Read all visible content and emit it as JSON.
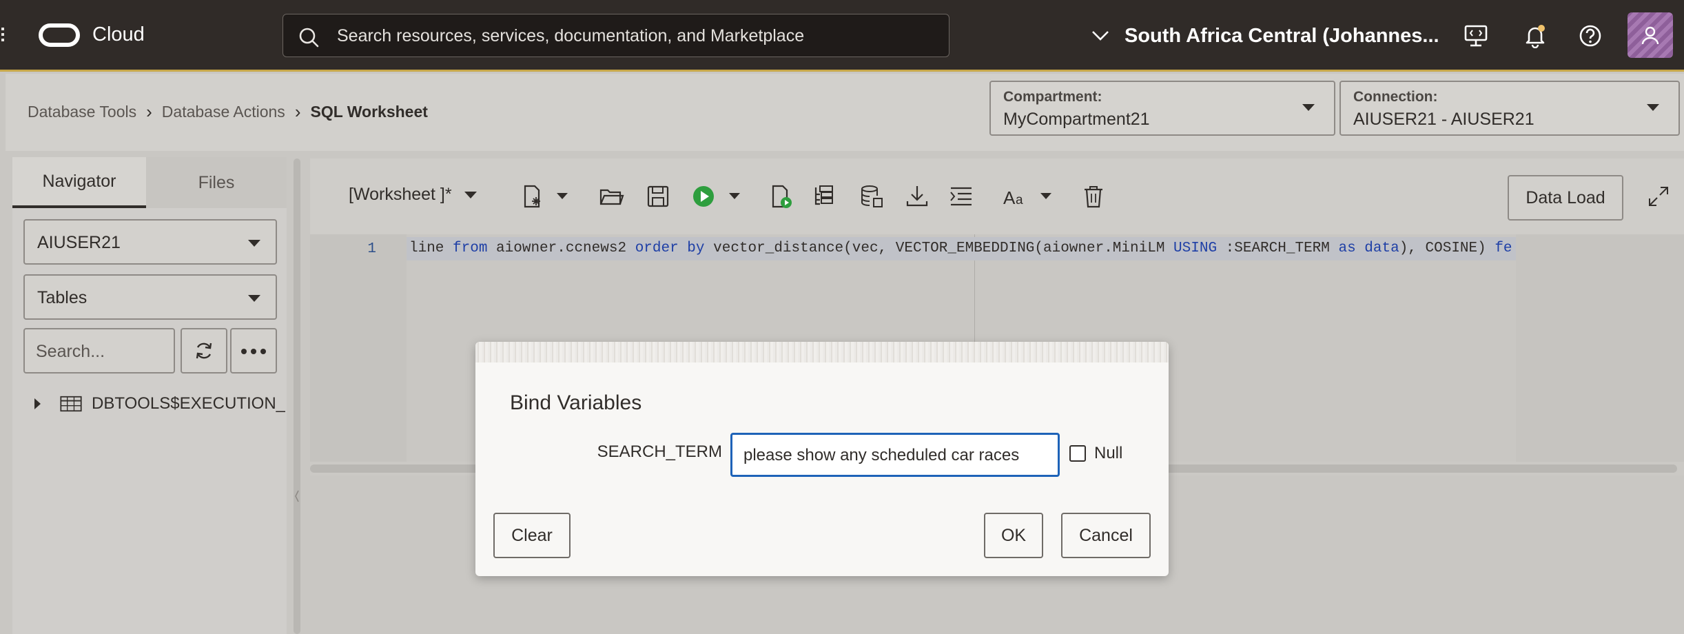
{
  "header": {
    "brand": "Cloud",
    "search_placeholder": "Search resources, services, documentation, and Marketplace",
    "region": "South Africa Central (Johannes..."
  },
  "breadcrumb": {
    "items": [
      "Database Tools",
      "Database Actions",
      "SQL Worksheet"
    ]
  },
  "compartment": {
    "label": "Compartment:",
    "value": "MyCompartment21"
  },
  "connection": {
    "label": "Connection:",
    "value": "AIUSER21 - AIUSER21"
  },
  "navigator": {
    "tabs": [
      "Navigator",
      "Files"
    ],
    "schema": "AIUSER21",
    "object_type": "Tables",
    "search_placeholder": "Search...",
    "tree_items": [
      "DBTOOLS$EXECUTION_"
    ]
  },
  "worksheet": {
    "name": "[Worksheet ]*",
    "data_load_label": "Data Load",
    "line_number": "1",
    "code_tokens": [
      {
        "t": "line ",
        "k": false
      },
      {
        "t": "from",
        "k": true
      },
      {
        "t": " aiowner.ccnews2 ",
        "k": false
      },
      {
        "t": "order by",
        "k": true
      },
      {
        "t": " vector_distance(vec, VECTOR_EMBEDDING(aiowner.MiniLM ",
        "k": false
      },
      {
        "t": "USING",
        "k": true
      },
      {
        "t": " :SEARCH_TERM ",
        "k": false
      },
      {
        "t": "as data",
        "k": true
      },
      {
        "t": "), COSINE) ",
        "k": false
      },
      {
        "t": "fe",
        "k": true
      }
    ]
  },
  "dialog": {
    "title": "Bind Variables",
    "variable_name": "SEARCH_TERM",
    "variable_value": "please show any scheduled car races",
    "null_label": "Null",
    "clear_label": "Clear",
    "ok_label": "OK",
    "cancel_label": "Cancel"
  },
  "colors": {
    "header_bg": "#302b28",
    "accent_blue": "#1e63b8",
    "run_green": "#2e9e3e",
    "notification_dot": "#f0c26b"
  }
}
